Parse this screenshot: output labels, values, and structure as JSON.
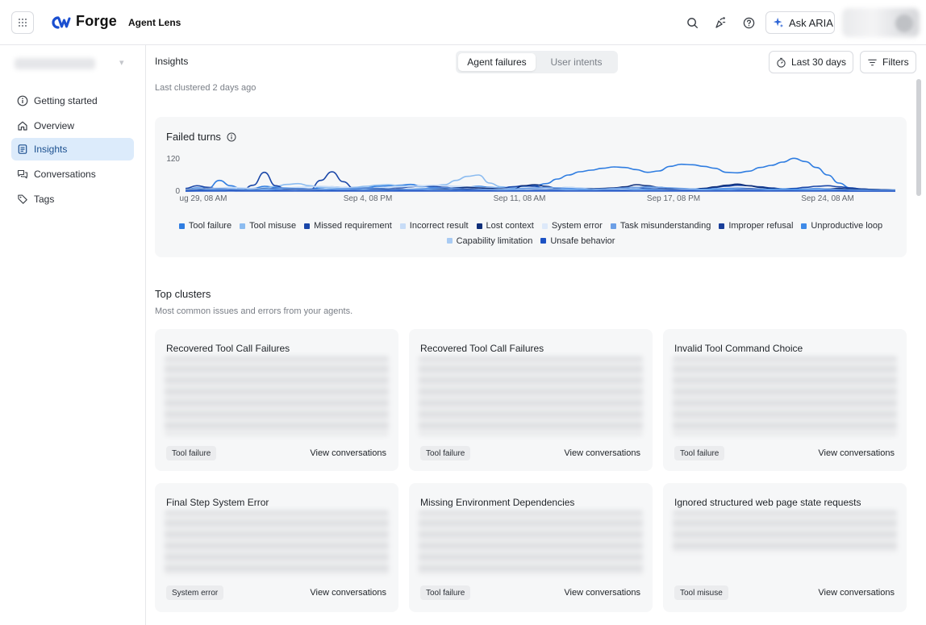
{
  "app": {
    "name": "Forge",
    "product": "Agent Lens",
    "ask_label": "Ask ARIA"
  },
  "sidebar": {
    "items": [
      {
        "label": "Getting started",
        "icon": "info-circle-icon",
        "active": false
      },
      {
        "label": "Overview",
        "icon": "home-icon",
        "active": false
      },
      {
        "label": "Insights",
        "icon": "document-list-icon",
        "active": true
      },
      {
        "label": "Conversations",
        "icon": "chat-bubbles-icon",
        "active": false
      },
      {
        "label": "Tags",
        "icon": "tag-icon",
        "active": false
      }
    ]
  },
  "header": {
    "title": "Insights",
    "tabs": [
      {
        "label": "Agent failures",
        "active": true
      },
      {
        "label": "User intents",
        "active": false
      }
    ],
    "date_range": "Last 30 days",
    "filters": "Filters",
    "clustered": "Last clustered 2 days ago"
  },
  "chart": {
    "title": "Failed turns",
    "accent_color": "#2f6fe0"
  },
  "chart_data": {
    "type": "line",
    "title": "Failed turns",
    "x_ticks": [
      "ug 29, 08 AM",
      "Sep 4, 08 PM",
      "Sep 11, 08 AM",
      "Sep 17, 08 PM",
      "Sep 24, 08 AM"
    ],
    "y_ticks": [
      0,
      120
    ],
    "ylim": [
      0,
      140
    ],
    "grid": false,
    "legend_position": "bottom",
    "series": [
      {
        "name": "Tool failure",
        "color": "#2f7de1",
        "values": [
          5,
          12,
          10,
          40,
          20,
          8,
          10,
          18,
          14,
          12,
          10,
          8,
          12,
          16,
          14,
          10,
          12,
          18,
          20,
          22,
          25,
          18,
          14,
          10,
          12,
          15,
          18,
          14,
          12,
          16,
          18,
          20,
          28,
          45,
          60,
          72,
          78,
          85,
          90,
          88,
          80,
          70,
          75,
          92,
          100,
          98,
          92,
          85,
          70,
          68,
          74,
          88,
          96,
          108,
          122,
          110,
          88,
          60,
          30,
          12,
          8,
          6,
          5,
          4
        ]
      },
      {
        "name": "Tool misuse",
        "color": "#8cbcf0",
        "values": [
          3,
          4,
          6,
          10,
          8,
          6,
          5,
          12,
          18,
          25,
          28,
          20,
          14,
          12,
          10,
          14,
          18,
          22,
          24,
          20,
          18,
          16,
          20,
          24,
          40,
          55,
          60,
          30,
          16,
          12,
          10,
          8,
          10,
          12,
          14,
          12,
          10,
          8,
          10,
          12,
          14,
          12,
          10,
          8,
          6,
          8,
          10,
          8,
          6,
          5,
          6,
          8,
          10,
          8,
          6,
          5,
          4,
          6,
          8,
          6,
          5,
          4,
          3,
          3
        ]
      },
      {
        "name": "Missed requirement",
        "color": "#1946a8",
        "values": [
          10,
          20,
          14,
          8,
          6,
          4,
          22,
          70,
          20,
          6,
          4,
          3,
          40,
          72,
          35,
          8,
          6,
          10,
          14,
          12,
          16,
          20,
          18,
          14,
          10,
          8,
          6,
          5,
          10,
          16,
          20,
          18,
          10,
          6,
          5,
          4,
          6,
          8,
          10,
          12,
          14,
          10,
          8,
          6,
          5,
          6,
          10,
          14,
          18,
          22,
          20,
          16,
          12,
          8,
          10,
          14,
          18,
          20,
          16,
          12,
          8,
          6,
          5,
          4
        ]
      },
      {
        "name": "Incorrect result",
        "color": "#c7dcf7",
        "values": [
          6,
          8,
          10,
          12,
          14,
          12,
          10,
          8,
          10,
          12,
          14,
          16,
          18,
          16,
          14,
          12,
          10,
          12,
          14,
          16,
          18,
          20,
          22,
          20,
          18,
          16,
          14,
          12,
          10,
          8,
          6,
          8,
          10,
          12,
          14,
          12,
          10,
          8,
          6,
          5,
          6,
          8,
          10,
          12,
          10,
          8,
          6,
          5,
          4,
          5,
          6,
          8,
          10,
          8,
          6,
          5,
          4,
          5,
          6,
          5,
          4,
          3,
          3,
          3
        ]
      },
      {
        "name": "Lost context",
        "color": "#0f2f7a",
        "values": [
          4,
          6,
          8,
          6,
          5,
          4,
          6,
          8,
          10,
          8,
          6,
          5,
          4,
          6,
          8,
          10,
          12,
          10,
          8,
          6,
          5,
          6,
          8,
          10,
          12,
          14,
          12,
          10,
          8,
          6,
          20,
          24,
          18,
          10,
          8,
          6,
          8,
          10,
          12,
          16,
          24,
          20,
          14,
          10,
          8,
          6,
          10,
          16,
          22,
          26,
          20,
          14,
          10,
          8,
          6,
          5,
          6,
          8,
          10,
          8,
          6,
          5,
          4,
          3
        ]
      },
      {
        "name": "System error",
        "color": "#dde9fa",
        "values": [
          2,
          3,
          4,
          3,
          2,
          3,
          4,
          5,
          4,
          3,
          2,
          3,
          4,
          5,
          6,
          5,
          4,
          3,
          4,
          5,
          6,
          5,
          4,
          3,
          4,
          5,
          6,
          5,
          4,
          3,
          4,
          5,
          6,
          5,
          4,
          3,
          4,
          5,
          6,
          5,
          4,
          3,
          4,
          5,
          6,
          5,
          4,
          3,
          4,
          5,
          6,
          5,
          4,
          3,
          4,
          5,
          6,
          5,
          4,
          3,
          2,
          2,
          2,
          2
        ]
      },
      {
        "name": "Task misunderstanding",
        "color": "#6c9fe6",
        "values": [
          3,
          5,
          7,
          9,
          8,
          6,
          5,
          7,
          9,
          11,
          10,
          8,
          6,
          7,
          9,
          11,
          12,
          10,
          8,
          6,
          7,
          9,
          11,
          12,
          10,
          8,
          6,
          5,
          6,
          8,
          10,
          12,
          14,
          12,
          10,
          8,
          6,
          8,
          10,
          12,
          14,
          16,
          14,
          12,
          10,
          8,
          6,
          8,
          10,
          12,
          10,
          8,
          6,
          5,
          6,
          8,
          10,
          8,
          6,
          5,
          4,
          3,
          3,
          3
        ]
      },
      {
        "name": "Improper refusal",
        "color": "#1a3f9a",
        "values": [
          2,
          3,
          4,
          5,
          4,
          3,
          2,
          3,
          4,
          5,
          6,
          5,
          4,
          3,
          4,
          5,
          6,
          7,
          6,
          5,
          4,
          3,
          4,
          5,
          6,
          7,
          6,
          5,
          4,
          3,
          4,
          5,
          6,
          7,
          6,
          5,
          4,
          3,
          4,
          5,
          6,
          7,
          8,
          7,
          6,
          5,
          4,
          5,
          6,
          7,
          8,
          7,
          6,
          5,
          4,
          3,
          4,
          5,
          4,
          3,
          2,
          2,
          2,
          2
        ]
      },
      {
        "name": "Unproductive loop",
        "color": "#3e8ae8",
        "values": [
          1,
          2,
          3,
          4,
          3,
          2,
          3,
          4,
          5,
          4,
          3,
          2,
          3,
          4,
          5,
          6,
          5,
          4,
          3,
          4,
          5,
          6,
          5,
          4,
          3,
          4,
          5,
          6,
          5,
          4,
          3,
          4,
          5,
          6,
          7,
          6,
          5,
          4,
          5,
          6,
          7,
          6,
          5,
          4,
          5,
          6,
          7,
          8,
          7,
          6,
          5,
          6,
          7,
          8,
          7,
          6,
          5,
          4,
          3,
          2,
          2,
          2,
          2,
          2
        ]
      },
      {
        "name": "Capability limitation",
        "color": "#a9cbf3",
        "values": [
          1,
          1,
          2,
          2,
          3,
          2,
          2,
          3,
          3,
          4,
          3,
          3,
          2,
          3,
          4,
          4,
          3,
          3,
          2,
          3,
          4,
          4,
          3,
          3,
          2,
          3,
          4,
          5,
          4,
          3,
          3,
          4,
          5,
          5,
          4,
          3,
          3,
          4,
          5,
          5,
          4,
          3,
          3,
          4,
          5,
          5,
          4,
          3,
          3,
          4,
          5,
          4,
          3,
          3,
          2,
          3,
          3,
          2,
          2,
          1,
          1,
          1,
          1,
          1
        ]
      },
      {
        "name": "Unsafe behavior",
        "color": "#1d52c4",
        "values": [
          0,
          1,
          1,
          1,
          2,
          1,
          1,
          1,
          2,
          2,
          1,
          1,
          1,
          2,
          2,
          2,
          1,
          1,
          1,
          2,
          2,
          2,
          1,
          1,
          1,
          2,
          2,
          2,
          1,
          1,
          1,
          2,
          2,
          2,
          1,
          1,
          1,
          2,
          2,
          2,
          1,
          1,
          1,
          2,
          2,
          2,
          1,
          1,
          1,
          2,
          2,
          2,
          1,
          1,
          1,
          1,
          1,
          1,
          1,
          0,
          0,
          0,
          0,
          0
        ]
      }
    ]
  },
  "clusters_section": {
    "title": "Top clusters",
    "subtitle": "Most common issues and errors from your agents."
  },
  "clusters": [
    {
      "title": "Recovered Tool Call Failures",
      "tag": "Tool failure",
      "link": "View conversations"
    },
    {
      "title": "Recovered Tool Call Failures",
      "tag": "Tool failure",
      "link": "View conversations"
    },
    {
      "title": "Invalid Tool Command Choice",
      "tag": "Tool failure",
      "link": "View conversations"
    },
    {
      "title": "Final Step System Error",
      "tag": "System error",
      "link": "View conversations"
    },
    {
      "title": "Missing Environment Dependencies",
      "tag": "Tool failure",
      "link": "View conversations"
    },
    {
      "title": "Ignored structured web page state requests",
      "tag": "Tool misuse",
      "link": "View conversations"
    }
  ]
}
